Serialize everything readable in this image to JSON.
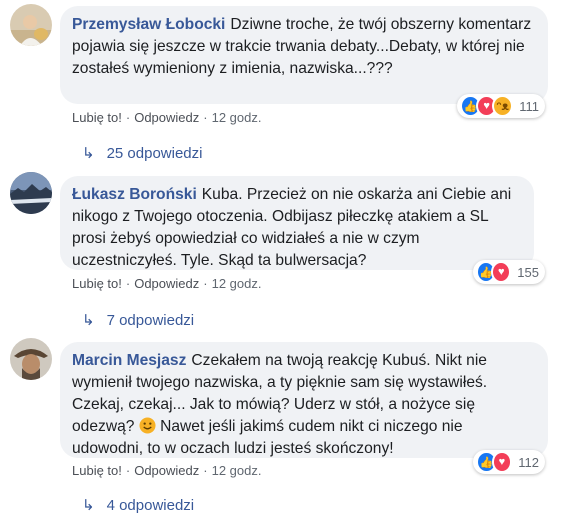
{
  "comments": [
    {
      "author": "Przemysław Łobocki",
      "text": "Dziwne troche, że twój obszerny komentarz pojawia się jeszcze w trakcie trwania debaty...Debaty, w której nie zostałeś wymieniony z imienia, nazwiska...???",
      "like_label": "Lubię to!",
      "reply_label": "Odpowiedz",
      "time": "12 godz.",
      "reaction_count": "111",
      "reactions": [
        "like",
        "love",
        "haha"
      ],
      "replies_label": "25 odpowiedzi"
    },
    {
      "author": "Łukasz Boroński",
      "text": "Kuba. Przecież on nie oskarża ani Ciebie ani nikogo z Twojego otoczenia. Odbijasz piłeczkę atakiem a SL prosi żebyś opowiedział co widziałeś a nie w czym uczestniczyłeś. Tyle. Skąd ta bulwersacja?",
      "like_label": "Lubię to!",
      "reply_label": "Odpowiedz",
      "time": "12 godz.",
      "reaction_count": "155",
      "reactions": [
        "like",
        "love"
      ],
      "replies_label": "7 odpowiedzi"
    },
    {
      "author": "Marcin Mesjasz",
      "text_before": "Czekałem na twoją reakcję Kubuś. Nikt nie wymienił twojego nazwiska, a ty pięknie sam się wystawiłeś. Czekaj, czekaj... Jak to mówią? Uderz w stół, a nożyce się odezwą?",
      "text_after": "Nawet jeśli jakimś cudem nikt ci niczego nie udowodni, to w oczach ludzi jesteś skończony!",
      "emoji": "smile-emoji",
      "like_label": "Lubię to!",
      "reply_label": "Odpowiedz",
      "time": "12 godz.",
      "reaction_count": "112",
      "reactions": [
        "like",
        "love"
      ],
      "replies_label": "4 odpowiedzi"
    }
  ],
  "colors": {
    "bubble": "#f0f2f5",
    "author": "#385898",
    "like": "#1877f2",
    "love": "#f33e58",
    "haha": "#f7b125"
  }
}
